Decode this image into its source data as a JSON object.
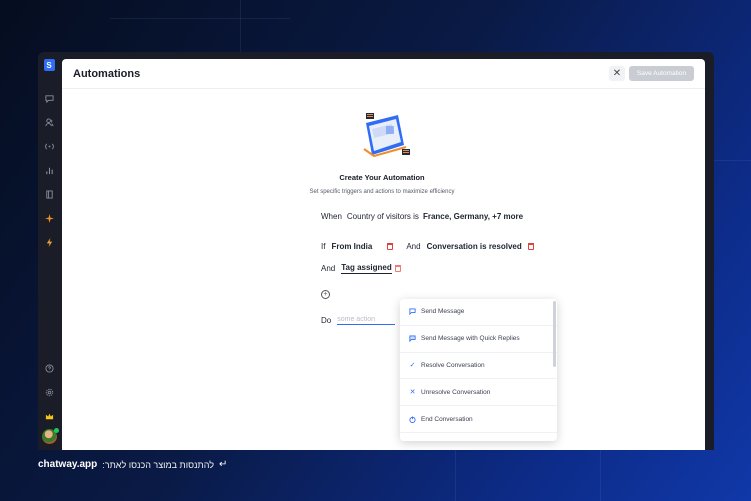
{
  "panel": {
    "title": "Automations",
    "close_icon": "✕",
    "save_label": "Save Automation"
  },
  "empty_state": {
    "title": "Create Your Automation",
    "subtitle": "Set specific triggers and actions to maximize efficiency"
  },
  "rule": {
    "when_label": "When",
    "when_text": "Country of visitors is",
    "when_value": "France, Germany, +7 more",
    "if_label": "If",
    "if_value": "From India",
    "and1_label": "And",
    "and1_value": "Conversation is resolved",
    "and2_label": "And",
    "and2_value": "Tag assigned",
    "do_label": "Do",
    "action_placeholder": "some action"
  },
  "action_menu": {
    "items": [
      {
        "label": "Send Message",
        "icon": "chat-bubble-icon"
      },
      {
        "label": "Send Message with Quick Replies",
        "icon": "quick-reply-icon"
      },
      {
        "label": "Resolve Conversation",
        "icon": "check-icon"
      },
      {
        "label": "Unresolve Conversation",
        "icon": "x-icon"
      },
      {
        "label": "End Conversation",
        "icon": "power-icon"
      }
    ]
  },
  "footer": {
    "brand": "chatway.app",
    "text": "להתנסות במוצר הכנסו לאתר:"
  },
  "colors": {
    "accent": "#2f6df6",
    "danger": "#e0413a",
    "online": "#23c55e"
  }
}
